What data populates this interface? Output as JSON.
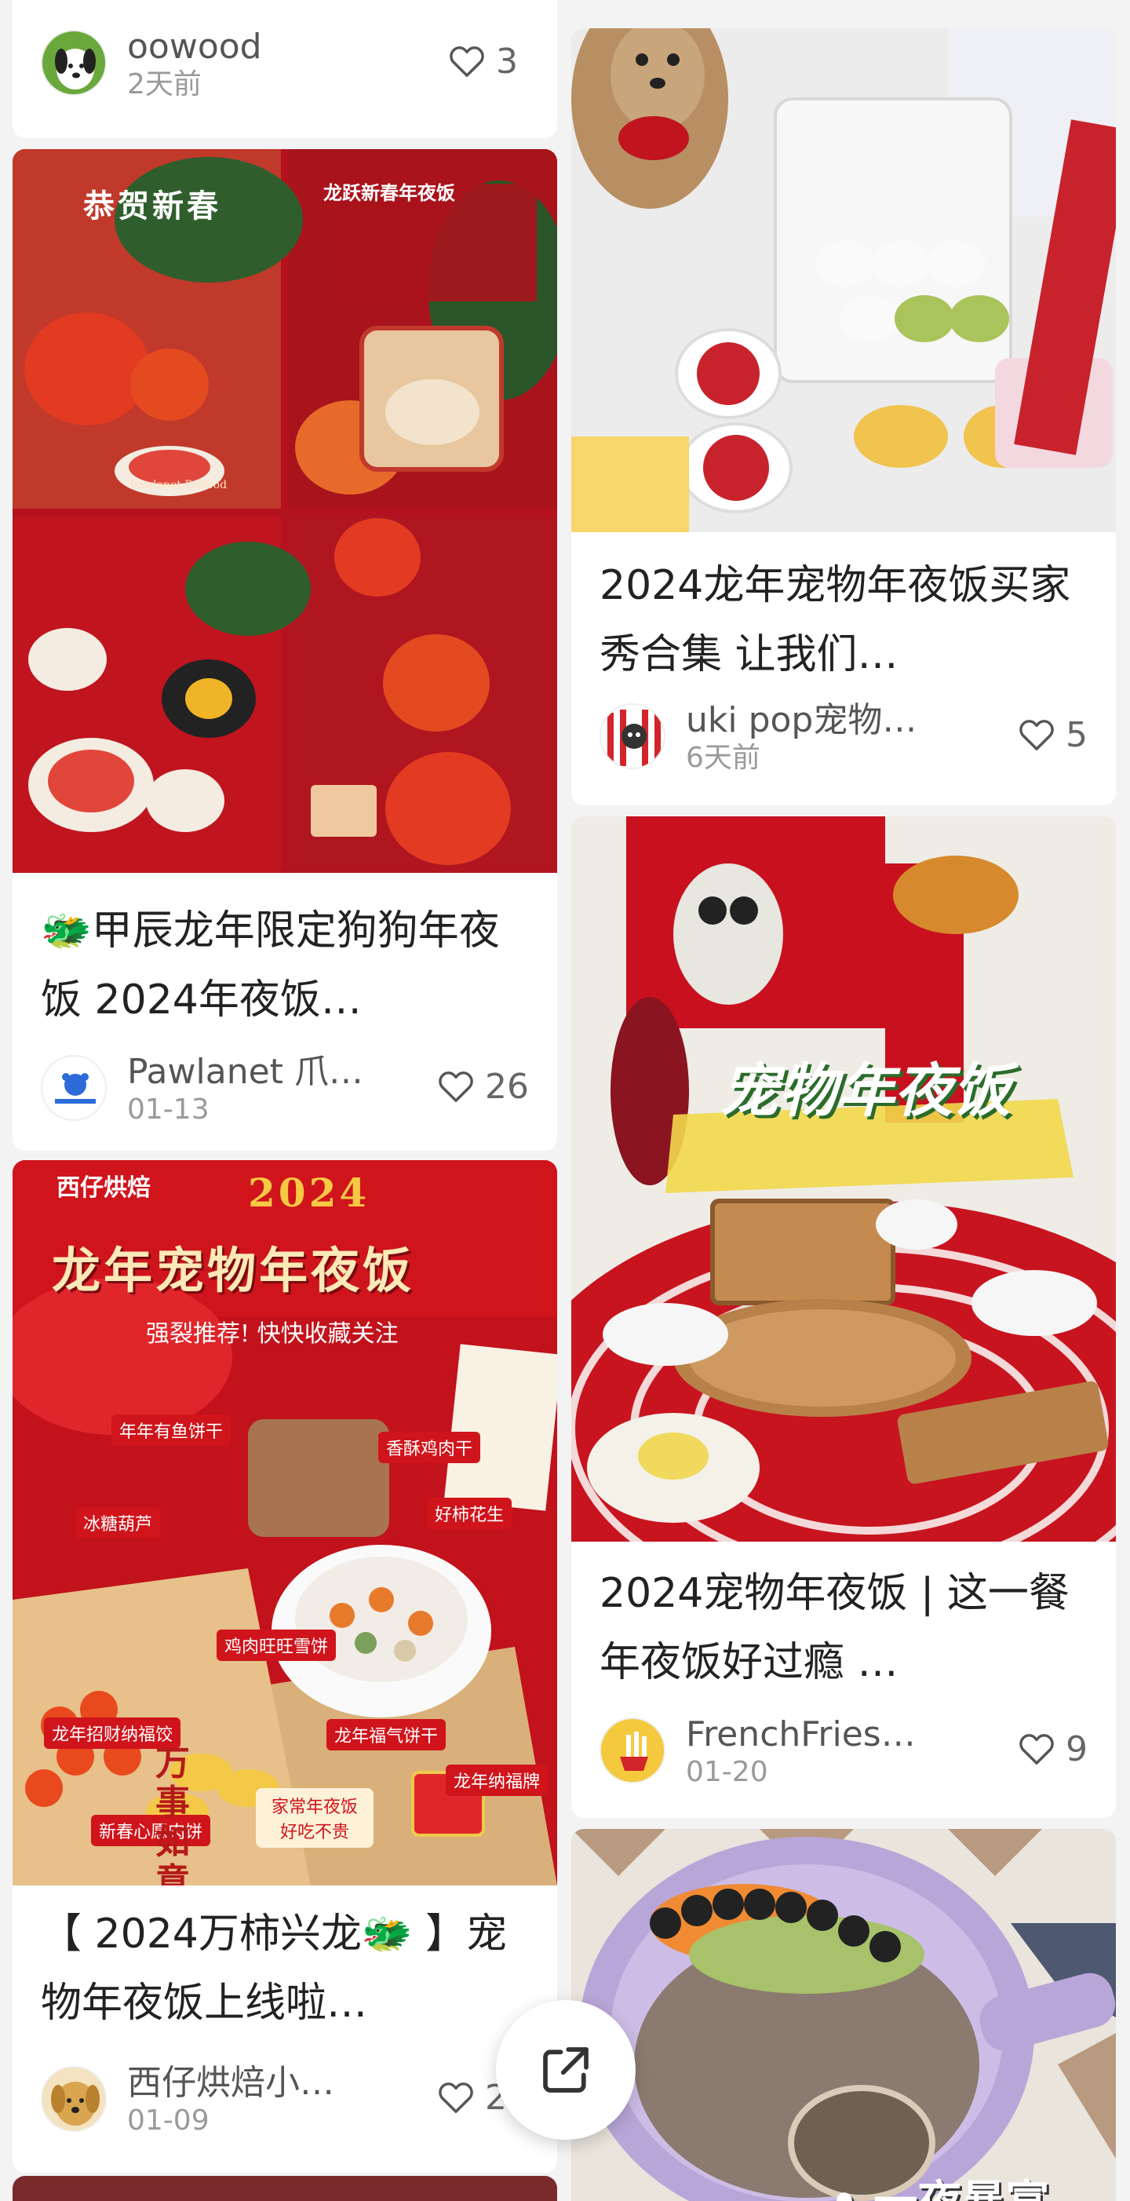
{
  "posts": [
    {
      "author": "oowood",
      "date": "2天前",
      "likes": "3"
    },
    {
      "title": "2024龙年宠物年夜饭买家秀合集 让我们…",
      "author": "uki pop宠物…",
      "date": "6天前",
      "likes": "5"
    },
    {
      "title": "🐲甲辰龙年限定狗狗年夜饭 2024年夜饭…",
      "author": "Pawlanet 爪…",
      "date": "01-13",
      "likes": "26",
      "cover_text": [
        "恭贺新春",
        "龙跃新春年夜饭",
        "Pawlanet Petfood"
      ]
    },
    {
      "title": "2024宠物年夜饭 | 这一餐年夜饭好过瘾 …",
      "author": "FrenchFries一…",
      "date": "01-20",
      "likes": "9",
      "cover_text": [
        "宠物年夜饭"
      ]
    },
    {
      "title": "【 2024万柿兴龙🐲 】宠物年夜饭上线啦…",
      "author": "西仔烘焙小…",
      "date": "01-09",
      "likes": "22",
      "cover_text": [
        "西仔烘焙",
        "2024",
        "龙年宠物年夜饭",
        "强裂推荐! 快快收藏关注",
        "香酥鸡肉干",
        "年年有鱼饼干",
        "冰糖葫芦",
        "好柿花生",
        "鸡肉旺旺雪饼",
        "龙年招财纳福饺",
        "龙年福气饼干",
        "龙年纳福牌",
        "新春心愿肉饼",
        "家常年夜饭 好吃不贵",
        "万事如意"
      ]
    },
    {
      "cover_text": [
        "• 一夜暴富"
      ]
    }
  ],
  "icons": {
    "heart": "heart-icon",
    "share": "share-icon"
  },
  "colors": {
    "accent_red": "#c8102e",
    "text_primary": "#222222",
    "text_secondary": "#9a9a9a"
  }
}
